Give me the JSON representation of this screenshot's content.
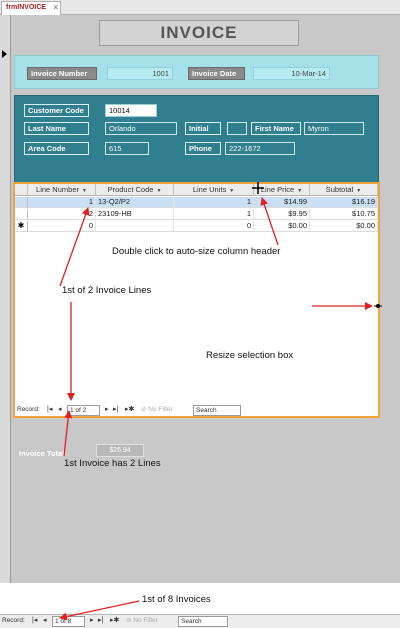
{
  "tab": {
    "label": "frmINVOICE",
    "close": "×"
  },
  "form": {
    "title": "INVOICE",
    "invoice_number_label": "Invoice Number",
    "invoice_number": "1001",
    "invoice_date_label": "Invoice Date",
    "invoice_date": "10-Mar-14",
    "customer_code_label": "Customer Code",
    "customer_code": "10014",
    "last_name_label": "Last Name",
    "last_name": "Orlando",
    "initial_label": "Initial",
    "initial": "",
    "first_name_label": "First Name",
    "first_name": "Myron",
    "area_code_label": "Area Code",
    "area_code": "615",
    "phone_label": "Phone",
    "phone": "222-1672",
    "invoice_total_label": "Invoice Total",
    "invoice_total": "$26.94"
  },
  "subform": {
    "columns": [
      "Line Number",
      "Product Code",
      "Line Units",
      "Line Price",
      "Subtotal"
    ],
    "rows": [
      {
        "line_number": "1",
        "product_code": "13-Q2/P2",
        "line_units": "1",
        "line_price": "$14.99",
        "subtotal": "$16.19"
      },
      {
        "line_number": "2",
        "product_code": "23109-HB",
        "line_units": "1",
        "line_price": "$9.95",
        "subtotal": "$10.75"
      },
      {
        "line_number": "0",
        "product_code": "",
        "line_units": "0",
        "line_price": "$0.00",
        "subtotal": "$0.00"
      }
    ],
    "new_row_marker": "✱",
    "nav": {
      "record_label": "Record:",
      "position": "1 of 2",
      "no_filter": "No Filter",
      "search": "Search"
    }
  },
  "main_nav": {
    "record_label": "Record:",
    "position": "1 of 8",
    "no_filter": "No Filter",
    "search": "Search"
  },
  "annotations": {
    "autosize": "Double click to auto-size column header",
    "lines": "1st of 2 Invoice Lines",
    "resize": "Resize selection box",
    "invoice_lines": "1st Invoice has 2 Lines",
    "invoices": "1st of 8 Invoices"
  },
  "colors": {
    "panel_light": "#a6e1ea",
    "panel_dark": "#2f7f8e",
    "selection_border": "#f4a23a",
    "annotation_arrow": "#e02020"
  }
}
